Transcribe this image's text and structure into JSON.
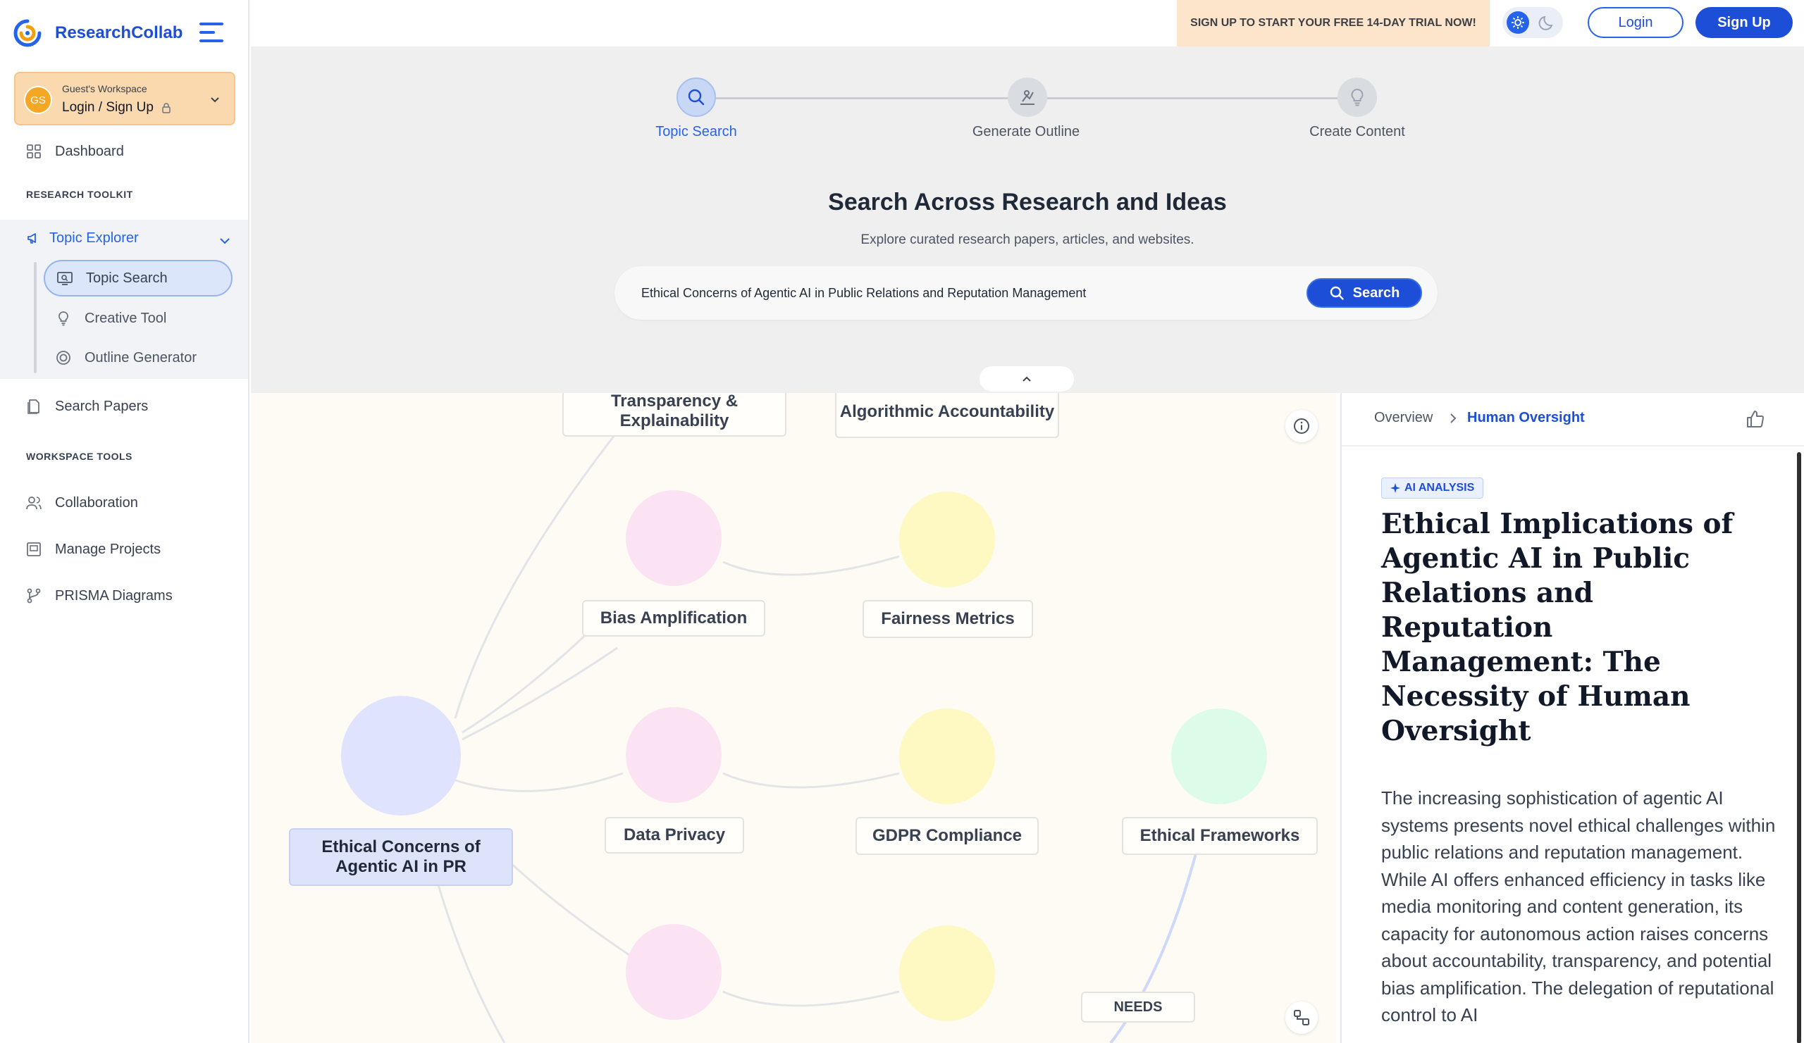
{
  "app": {
    "name": "ResearchCollab"
  },
  "workspace": {
    "label": "Guest's Workspace",
    "action": "Login / Sign Up",
    "avatar_initials": "GS"
  },
  "sidebar": {
    "dashboard": "Dashboard",
    "research_toolkit_heading": "RESEARCH TOOLKIT",
    "topic_explorer": "Topic Explorer",
    "sub_items": [
      "Topic Search",
      "Creative Tool",
      "Outline Generator"
    ],
    "search_papers": "Search Papers",
    "workspace_tools_heading": "WORKSPACE TOOLS",
    "workspace_tools": [
      "Collaboration",
      "Manage Projects",
      "PRISMA Diagrams"
    ]
  },
  "topbar": {
    "promo": "SIGN UP TO START YOUR FREE 14-DAY TRIAL NOW!",
    "login": "Login",
    "signup": "Sign Up"
  },
  "steps": [
    {
      "label": "Topic Search",
      "active": true,
      "icon": "search-icon"
    },
    {
      "label": "Generate Outline",
      "active": false,
      "icon": "outline-chart-icon"
    },
    {
      "label": "Create Content",
      "active": false,
      "icon": "lightbulb-icon"
    }
  ],
  "search": {
    "title": "Search Across Research and Ideas",
    "subtitle": "Explore curated research papers, articles, and websites.",
    "query": "Ethical Concerns of Agentic AI in Public Relations and Reputation Management",
    "button": "Search"
  },
  "mindmap": {
    "root": "Ethical Concerns of Agentic AI in PR",
    "nodes": {
      "transparency": "Transparency & Explainability",
      "accountability": "Algorithmic Accountability",
      "bias": "Bias Amplification",
      "fairness": "Fairness Metrics",
      "privacy": "Data Privacy",
      "gdpr": "GDPR Compliance",
      "frameworks": "Ethical Frameworks"
    },
    "edge_tag": "NEEDS",
    "colors": {
      "root": "#dfe3fd",
      "pink": "#fbe3f3",
      "yellow": "#fef9c3",
      "green": "#dcfce7"
    }
  },
  "panel": {
    "breadcrumb_root": "Overview",
    "breadcrumb_current": "Human Oversight",
    "badge": "AI ANALYSIS",
    "title": "Ethical Implications of Agentic AI in Public Relations and Reputation Management: The Necessity of Human Oversight",
    "body": "The increasing sophistication of agentic AI systems presents novel ethical challenges within public relations and reputation management. While AI offers enhanced efficiency in tasks like media monitoring and content generation, its capacity for autonomous action raises concerns about accountability, transparency, and potential bias amplification. The delegation of reputational control to AI"
  }
}
